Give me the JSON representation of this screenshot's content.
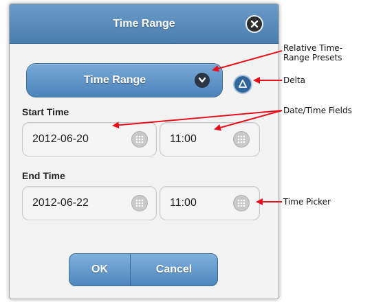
{
  "dialog": {
    "title": "Time Range",
    "preset_label": "Time Range",
    "start_label": "Start Time",
    "end_label": "End Time",
    "start_date": "2012-06-20",
    "start_time": "11:00",
    "end_date": "2012-06-22",
    "end_time": "11:00",
    "ok_label": "OK",
    "cancel_label": "Cancel"
  },
  "annotations": {
    "presets_line1": "Relative Time-",
    "presets_line2": "Range Presets",
    "delta": "Delta",
    "fields": "Date/Time Fields",
    "picker": "Time Picker"
  },
  "icons": {
    "close": "close-icon",
    "chevron": "chevron-down-icon",
    "delta": "delta-icon",
    "picker": "grid-icon"
  },
  "colors": {
    "header": "#4a7eae",
    "button": "#4e87bd",
    "arrow": "#e8101a"
  }
}
